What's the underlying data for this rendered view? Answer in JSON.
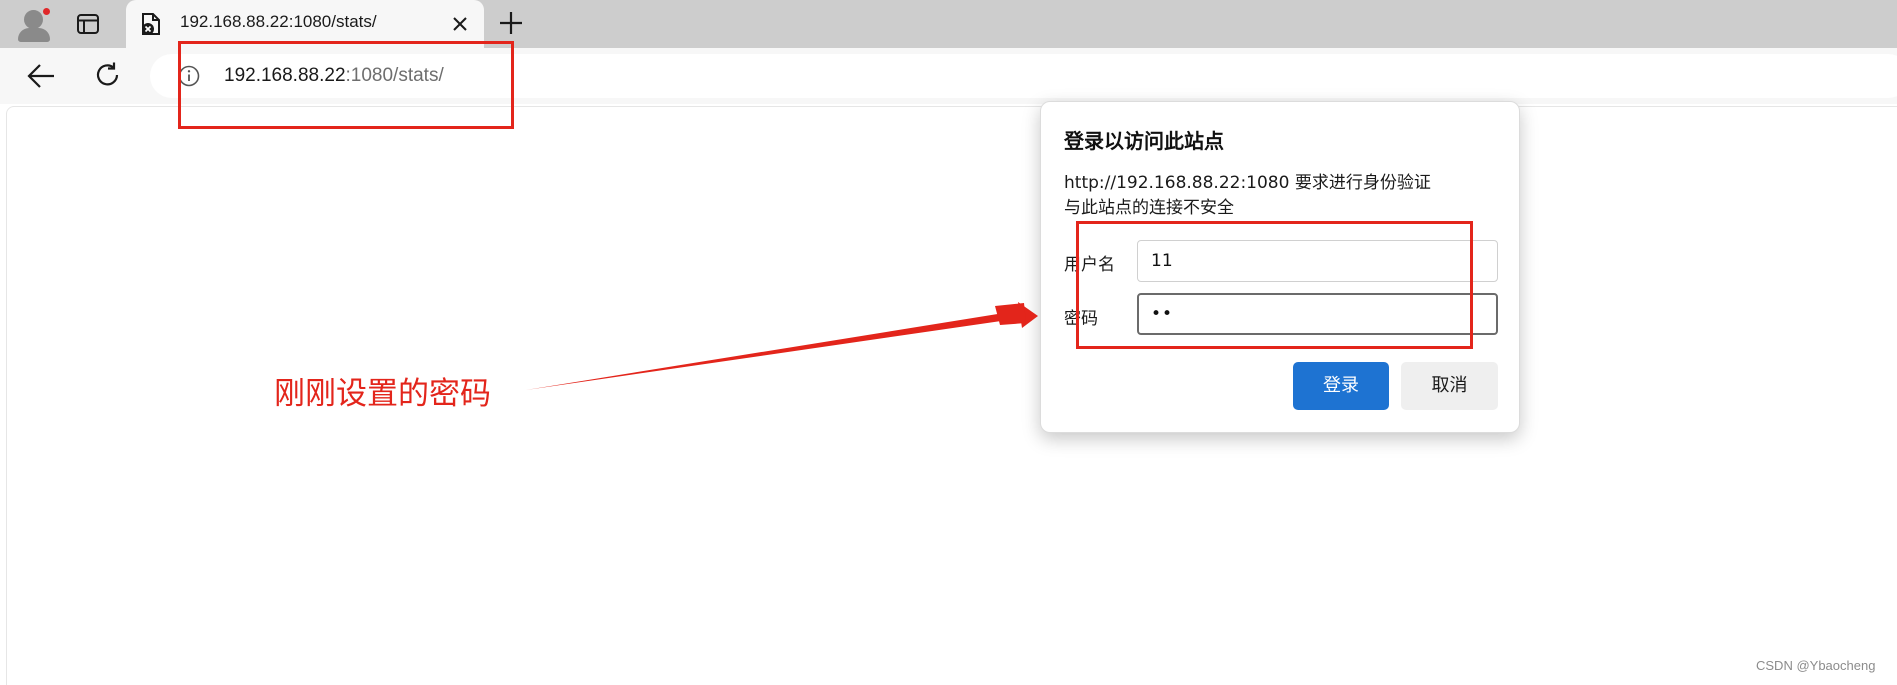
{
  "tab": {
    "title": "192.168.88.22:1080/stats/"
  },
  "address_bar": {
    "host": "192.168.88.22",
    "path": ":1080/stats/"
  },
  "dialog": {
    "title": "登录以访问此站点",
    "message_line1": "http://192.168.88.22:1080 要求进行身份验证",
    "message_line2": "与此站点的连接不安全",
    "username_label": "用户名",
    "username_value": "11",
    "password_label": "密码",
    "password_value": "••",
    "login_button": "登录",
    "cancel_button": "取消"
  },
  "annotation": {
    "text": "刚刚设置的密码",
    "color": "#e3251b"
  },
  "watermark": "CSDN @Ybaocheng",
  "colors": {
    "accent": "#1e73d2",
    "annotation_red": "#e3251b",
    "notification_dot": "#e0282a"
  }
}
